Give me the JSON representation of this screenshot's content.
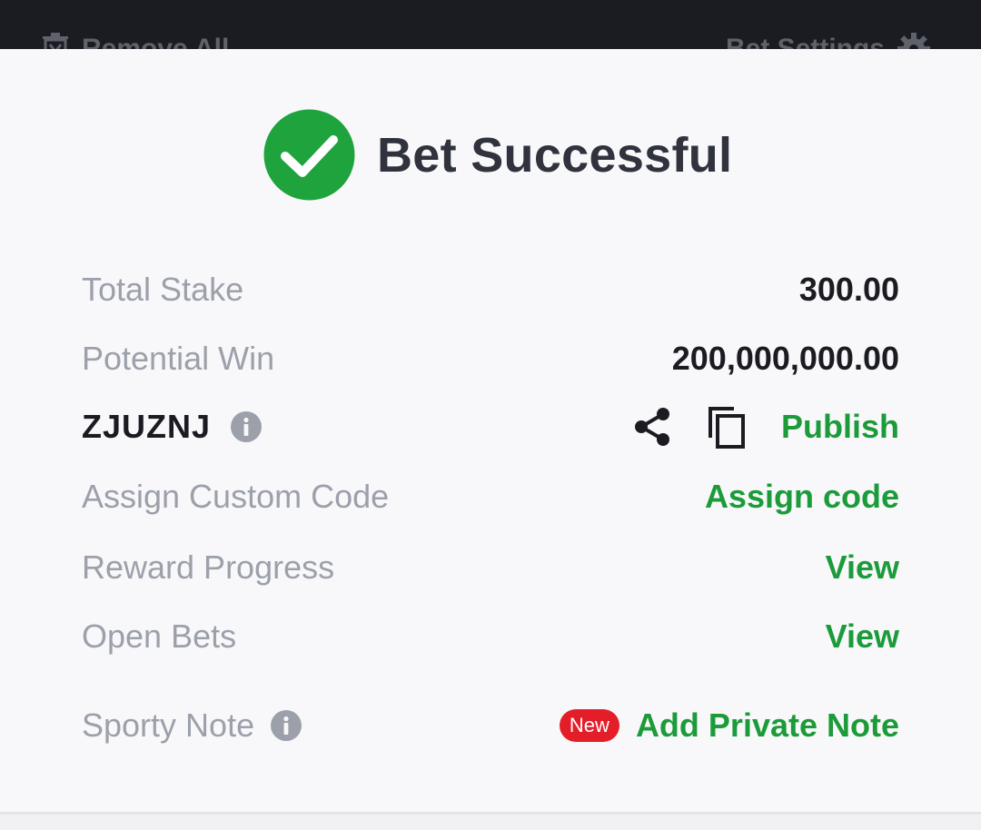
{
  "topbar": {
    "remove_all_label": "Remove All",
    "bet_settings_label": "Bet Settings"
  },
  "header": {
    "title": "Bet Successful"
  },
  "rows": {
    "total_stake": {
      "label": "Total Stake",
      "value": "300.00"
    },
    "potential_win": {
      "label": "Potential Win",
      "value": "200,000,000.00"
    },
    "booking": {
      "code": "ZJUZNJ",
      "publish_label": "Publish"
    },
    "custom_code": {
      "label": "Assign Custom Code",
      "action": "Assign code"
    },
    "reward_progress": {
      "label": "Reward Progress",
      "action": "View"
    },
    "open_bets": {
      "label": "Open Bets",
      "action": "View"
    },
    "sporty_note": {
      "label": "Sporty Note",
      "badge": "New",
      "action": "Add Private Note"
    }
  },
  "colors": {
    "accent_green": "#1b9b3a",
    "success_icon": "#1ea33d",
    "badge_red": "#e41e28",
    "label_gray": "#9ca0aa",
    "text_dark": "#1b1c22",
    "topbar_bg": "#1b1c22"
  },
  "icons": {
    "remove_all": "trash-icon",
    "bet_settings": "gear-icon",
    "success": "check-circle-icon",
    "info": "info-icon",
    "share": "share-icon",
    "copy": "copy-icon"
  }
}
